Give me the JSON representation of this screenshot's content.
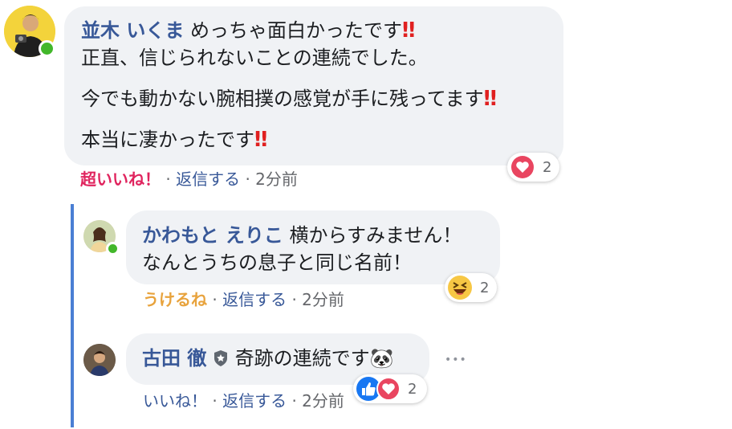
{
  "comment1": {
    "author": "並木 いくま",
    "text_line1": "めっちゃ面白かったです",
    "text_line2": "正直、信じられないことの連続でした。",
    "text_line3": "今でも動かない腕相撲の感覚が手に残ってます",
    "text_line4": "本当に凄かったです",
    "emoji": "‼",
    "reaction_label": "超いいね！",
    "reply_label": "返信する",
    "time": "2分前",
    "sep": "·",
    "reaction_count": "2"
  },
  "reply1": {
    "author": "かわもと えりこ",
    "text_line1": "横からすみません！",
    "text_line2": "なんとうちの息子と同じ名前！",
    "reaction_label": "うけるね",
    "reply_label": "返信する",
    "time": "2分前",
    "sep": "·",
    "reaction_count": "2"
  },
  "reply2": {
    "author": "古田 徹",
    "text": "奇跡の連続です",
    "emoji": "🐼",
    "more": "•••",
    "reaction_label": "いいね！",
    "reply_label": "返信する",
    "time": "2分前",
    "sep": "·",
    "reaction_count": "2"
  },
  "colors": {
    "bubble": "#f0f2f5",
    "name": "#385898",
    "love": "#e0245e",
    "haha": "#e8a33d",
    "online": "#42b72a",
    "thread_bar": "#4a7fd4"
  },
  "icons": [
    "avatar",
    "online-dot",
    "heart-icon",
    "haha-icon",
    "like-icon",
    "verified-badge-icon",
    "more-icon"
  ]
}
